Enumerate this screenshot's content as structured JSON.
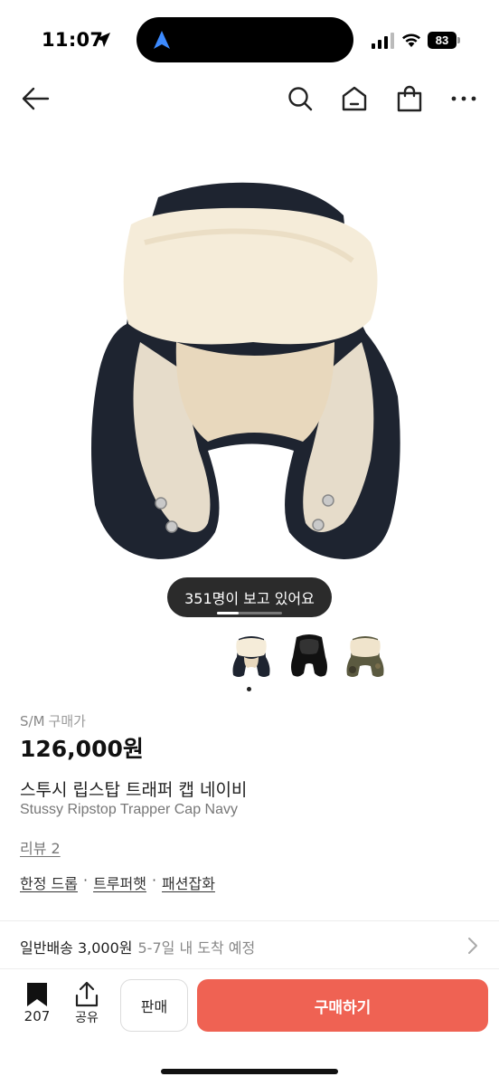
{
  "status_bar": {
    "time": "11:07",
    "battery": "83"
  },
  "nav": {
    "icons": [
      "back-arrow-icon",
      "search-icon",
      "home-icon",
      "shopping-bag-icon",
      "more-icon"
    ]
  },
  "gallery": {
    "viewers_text": "351명이 보고 있어요",
    "thumbnail_count": 3,
    "selected_index": 0
  },
  "product": {
    "size": "S/M",
    "size_sub": "구매가",
    "price": "126,000원",
    "title_ko": "스투시 립스탑 트래퍼 캡 네이비",
    "title_en": "Stussy Ripstop Trapper Cap Navy",
    "review_link": "리뷰 2",
    "tags": [
      "한정 드롭",
      "트루퍼햇",
      "패션잡화"
    ]
  },
  "shipping": {
    "label": "일반배송 3,000원",
    "eta": "5-7일 내 도착 예정"
  },
  "bottom_bar": {
    "bookmark_count": "207",
    "share_label": "공유",
    "sell_label": "판매",
    "buy_label": "구매하기",
    "buy_color": "#ef6253"
  }
}
